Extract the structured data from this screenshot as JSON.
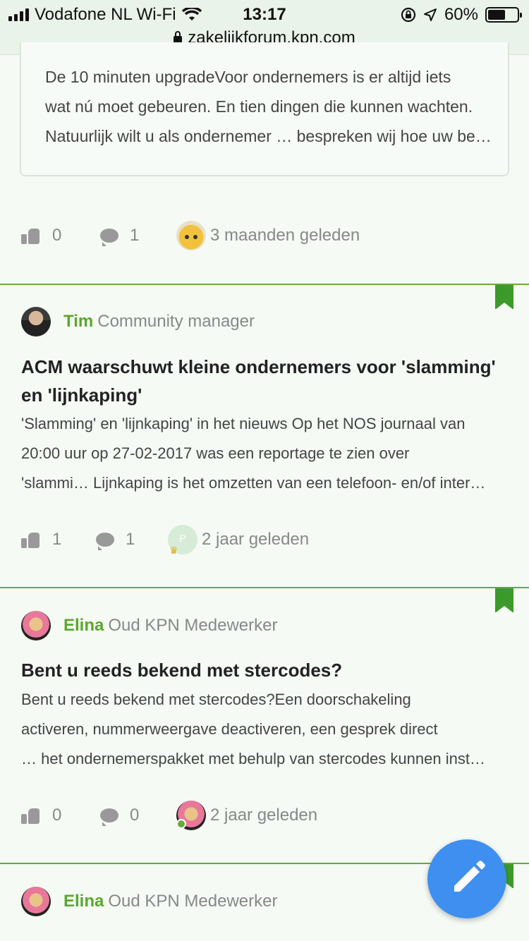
{
  "status_bar": {
    "carrier": "Vodafone NL Wi-Fi",
    "time": "13:17",
    "battery": "60%",
    "battery_level": 0.6
  },
  "url": "zakelijkforum.kpn.com",
  "preview": {
    "lines": [
      "De 10 minuten upgradeVoor ondernemers is er altijd iets",
      "wat nú moet gebeuren. En tien dingen die kunnen wachten.",
      "Natuurlijk wilt u als ondernemer … bespreken wij hoe uw be…"
    ],
    "likes": "0",
    "comments": "1",
    "time": "3 maanden geleden"
  },
  "posts": [
    {
      "author": "Tim",
      "role": "Community manager",
      "title_lines": [
        "ACM waarschuwt kleine ondernemers voor 'slamming'",
        "en 'lijnkaping'"
      ],
      "excerpt": [
        "'Slamming' en 'lijnkaping' in het nieuws Op het NOS journaal van",
        "20:00 uur op 27-02-2017 was een reportage te zien over",
        "'slammi… Lijnkaping is het omzetten van een telefoon- en/of inter…"
      ],
      "likes": "1",
      "comments": "1",
      "avatar_letter": "P",
      "time": "2 jaar geleden"
    },
    {
      "author": "Elina",
      "role": "Oud KPN Medewerker",
      "title_lines": [
        "Bent u reeds bekend met stercodes?"
      ],
      "excerpt": [
        "Bent u reeds bekend met stercodes?Een doorschakeling",
        "activeren, nummerweergave deactiveren, een gesprek direct",
        "… het ondernemerspakket met behulp van stercodes kunnen inst…"
      ],
      "likes": "0",
      "comments": "0",
      "time": "2 jaar geleden"
    },
    {
      "author": "Elina",
      "role": "Oud KPN Medewerker"
    }
  ],
  "colors": {
    "accent_green": "#5aa82c",
    "bookmark_green": "#3c9a2a",
    "fab_blue": "#3f8ff0"
  }
}
